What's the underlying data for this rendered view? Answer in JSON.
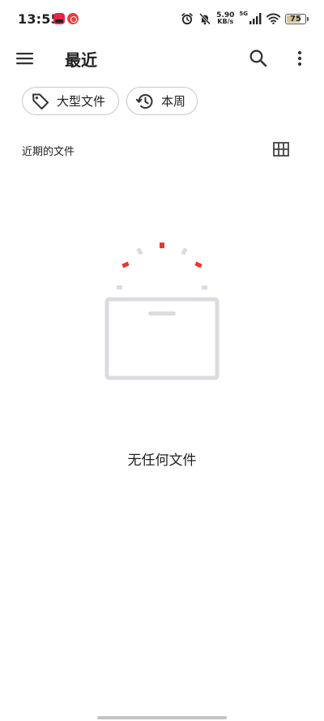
{
  "status_bar": {
    "time": "13:55",
    "net_speed_value": "5.90",
    "net_speed_unit": "KB/s",
    "signal_label": "5G",
    "battery_level": "75",
    "icons": [
      "alarm-icon",
      "mute-icon",
      "signal-icon",
      "wifi-icon",
      "battery-icon"
    ]
  },
  "app_bar": {
    "title": "最近"
  },
  "filters": {
    "large_files_label": "大型文件",
    "this_week_label": "本周"
  },
  "section": {
    "title": "近期的文件"
  },
  "empty_state": {
    "message": "无任何文件"
  },
  "colors": {
    "accent_red": "#e53935",
    "illustration_gray": "#dadce0",
    "chip_border": "#c7c7c7"
  }
}
